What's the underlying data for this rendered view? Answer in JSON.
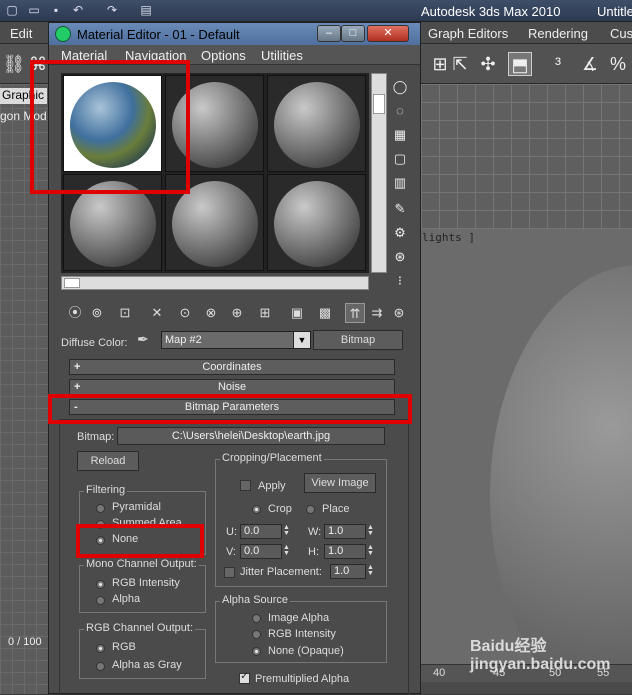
{
  "app": {
    "title": "Autodesk 3ds Max  2010",
    "title_right": "Untitle"
  },
  "main_menu": [
    "Edit",
    "Graph Editors",
    "Rendering",
    "Cus"
  ],
  "left_panel": {
    "graphite_tab": "Graphic",
    "poly_tab": "gon Mod",
    "frame_counter": "0 / 100"
  },
  "viewport": {
    "label": "lights ]",
    "ruler": [
      "40",
      "45",
      "50",
      "55"
    ]
  },
  "material_editor": {
    "title": "Material Editor - 01 - Default",
    "menu": [
      "Material",
      "Navigation",
      "Options",
      "Utilities"
    ],
    "window_buttons": {
      "minimize": "–",
      "maximize": "□",
      "close": "✕"
    },
    "diffuse_label": "Diffuse Color:",
    "map_name": "Map #2",
    "map_type": "Bitmap",
    "rollouts": [
      {
        "sign": "+",
        "label": "Coordinates"
      },
      {
        "sign": "+",
        "label": "Noise"
      },
      {
        "sign": "-",
        "label": "Bitmap Parameters"
      }
    ],
    "bitmap_label": "Bitmap:",
    "bitmap_path": "C:\\Users\\helei\\Desktop\\earth.jpg",
    "reload": "Reload",
    "filtering": {
      "title": "Filtering",
      "options": [
        "Pyramidal",
        "Summed Area",
        "None"
      ],
      "selected": "None"
    },
    "mono_output": {
      "title": "Mono Channel Output:",
      "options": [
        "RGB Intensity",
        "Alpha"
      ],
      "selected": "RGB Intensity"
    },
    "rgb_output": {
      "title": "RGB Channel Output:",
      "options": [
        "RGB",
        "Alpha as Gray"
      ],
      "selected": "RGB"
    },
    "cropping": {
      "title": "Cropping/Placement",
      "apply": "Apply",
      "view_image": "View Image",
      "crop": "Crop",
      "place": "Place",
      "selected": "Crop",
      "u_label": "U:",
      "u": "0.0",
      "w_label": "W:",
      "w": "1.0",
      "v_label": "V:",
      "v": "0.0",
      "h_label": "H:",
      "h": "1.0",
      "jitter_label": "Jitter Placement:",
      "jitter": "1.0"
    },
    "alpha_source": {
      "title": "Alpha Source",
      "options": [
        "Image Alpha",
        "RGB Intensity",
        "None (Opaque)"
      ],
      "selected": "None (Opaque)"
    },
    "premultiplied": "Premultiplied Alpha"
  },
  "watermark": "Baidu经验 jingyan.baidu.com",
  "colors": {
    "highlight": "#e00000",
    "titlebar": "#5a7aa8"
  }
}
